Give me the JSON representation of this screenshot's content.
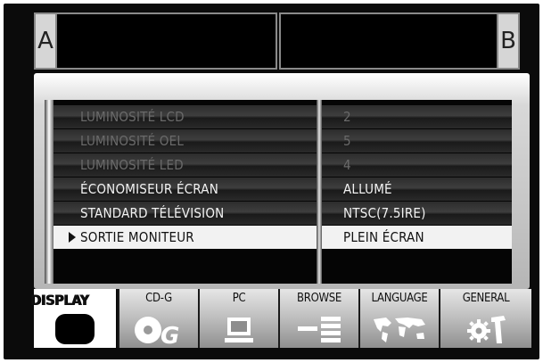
{
  "panels": {
    "left_tag": "A",
    "right_tag": "B"
  },
  "menu": {
    "rows": [
      {
        "label": "LUMINOSITÉ LCD",
        "value": "2",
        "state": "dim"
      },
      {
        "label": "LUMINOSITÉ OEL",
        "value": "5",
        "state": "dim"
      },
      {
        "label": "LUMINOSITÉ LED",
        "value": "4",
        "state": "dim"
      },
      {
        "label": "ÉCONOMISEUR ÉCRAN",
        "value": "ALLUMÉ",
        "state": "normal"
      },
      {
        "label": "STANDARD TÉLÉVISION",
        "value": "NTSC(7.5IRE)",
        "state": "normal"
      },
      {
        "label": "SORTIE MONITEUR",
        "value": "PLEIN ÉCRAN",
        "state": "selected"
      }
    ]
  },
  "tabs": [
    {
      "label": "DISPLAY",
      "icon": "monitor-icon",
      "active": true
    },
    {
      "label": "CD-G",
      "icon": "disc-g-icon",
      "active": false
    },
    {
      "label": "PC",
      "icon": "computer-icon",
      "active": false
    },
    {
      "label": "BROWSE",
      "icon": "list-icon",
      "active": false
    },
    {
      "label": "LANGUAGE",
      "icon": "world-map-icon",
      "active": false
    },
    {
      "label": "GENERAL",
      "icon": "tools-icon",
      "active": false
    }
  ]
}
